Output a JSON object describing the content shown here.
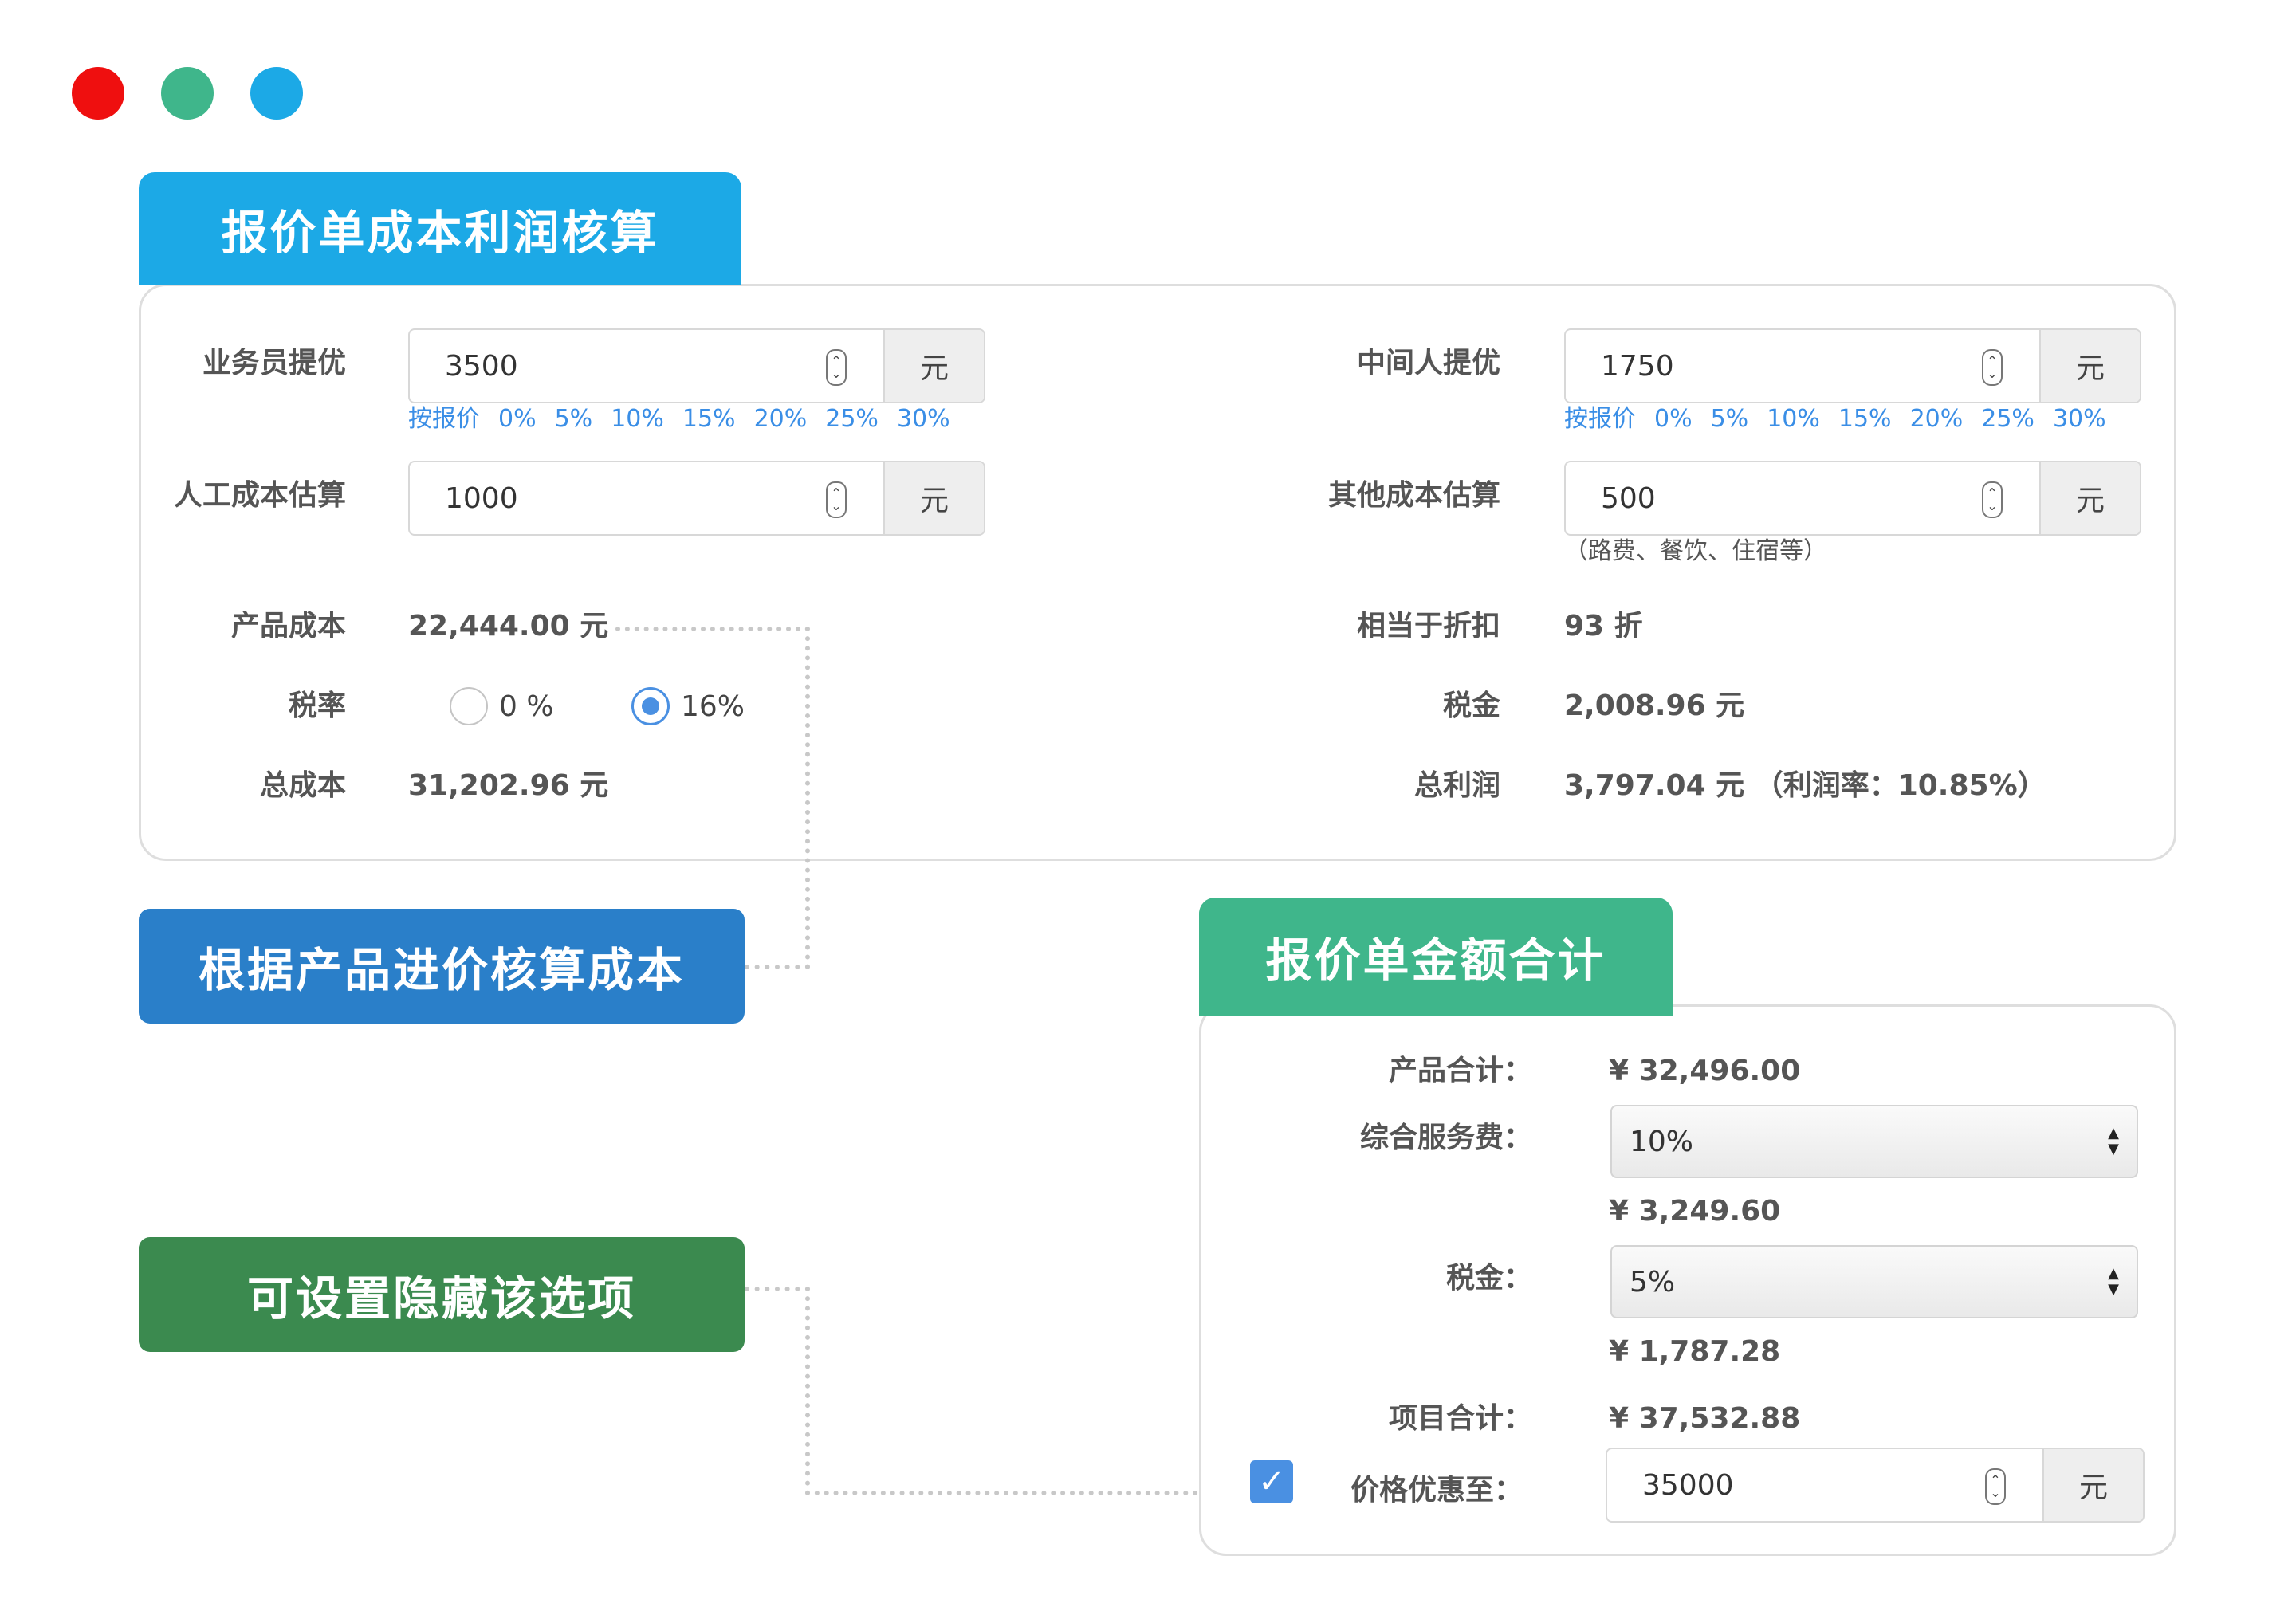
{
  "window_controls": {
    "close_color": "#ef0f0f",
    "minimize_color": "#3fb68b",
    "maximize_color": "#1ca9e6"
  },
  "cost_panel": {
    "title": "报价单成本利润核算",
    "salesman_label": "业务员提优",
    "salesman_value": "3500",
    "middleman_label": "中间人提优",
    "middleman_value": "1750",
    "labor_label": "人工成本估算",
    "labor_value": "1000",
    "other_label": "其他成本估算",
    "other_value": "500",
    "other_hint": "（路费、餐饮、住宿等）",
    "unit": "元",
    "quick_options": [
      "按报价",
      "0%",
      "5%",
      "10%",
      "15%",
      "20%",
      "25%",
      "30%"
    ],
    "product_cost_label": "产品成本",
    "product_cost_value": "22,444.00 元",
    "discount_label": "相当于折扣",
    "discount_value": "93 折",
    "tax_rate_label": "税率",
    "tax_rate_options": [
      "0 %",
      "16%"
    ],
    "tax_rate_selected": "16%",
    "tax_label": "税金",
    "tax_value": "2,008.96 元",
    "total_cost_label": "总成本",
    "total_cost_value": "31,202.96 元",
    "total_profit_label": "总利润",
    "total_profit_value": "3,797.04 元 （利润率：10.85%）"
  },
  "callouts": {
    "cost_by_purchase": "根据产品进价核算成本",
    "can_hide": "可设置隐藏该选项"
  },
  "total_panel": {
    "title": "报价单金额合计",
    "product_total_label": "产品合计：",
    "product_total_value": "¥ 32,496.00",
    "service_fee_label": "综合服务费：",
    "service_fee_selected": "10%",
    "service_fee_amount": "¥ 3,249.60",
    "tax_label": "税金：",
    "tax_selected": "5%",
    "tax_amount": "¥ 1,787.28",
    "item_total_label": "项目合计：",
    "item_total_value": "¥ 37,532.88",
    "discount_to_label": "价格优惠至：",
    "discount_to_value": "35000",
    "discount_enabled": true,
    "unit": "元"
  },
  "colors": {
    "blue_tab": "#1ca9e6",
    "dark_blue": "#2a7fc9",
    "green_tab": "#3fb68b",
    "dark_green": "#3b8a4f",
    "link": "#3a8ee6"
  }
}
